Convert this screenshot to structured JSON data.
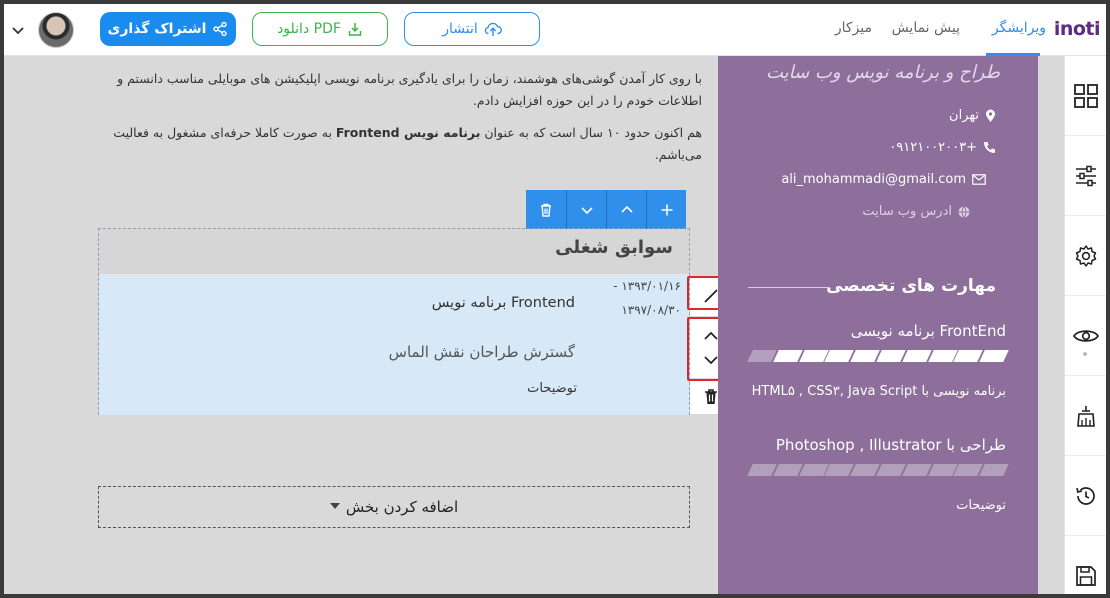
{
  "topbar": {
    "logo": "inoti",
    "nav": {
      "editor": "ویرایشگر",
      "preview": "پیش نمایش",
      "desk": "میزکار"
    },
    "buttons": {
      "publish": "انتشار",
      "pdf": "دانلود PDF",
      "share": "اشتراک گذاری"
    }
  },
  "intro": {
    "para1": "با روی کار آمدن گوشی‌های هوشمند، زمان را برای یادگیری برنامه نویسی اپلیکیشن های موبایلی مناسب دانستم و اطلاعات خودم را در این حوزه افزایش دادم.",
    "para2_before": "هم اکنون حدود ۱۰ سال است که به عنوان ",
    "para2_bold": "برنامه نویس Frontend",
    "para2_after": " به صورت کاملا حرفه‌ای مشغول به فعالیت می‌باشم."
  },
  "section": {
    "title": "سوابق شغلی",
    "date_start": "۱۳۹۳/۰۱/۱۶ -",
    "date_end": "۱۳۹۷/۰۸/۳۰",
    "job_title": "برنامه نویس Frontend",
    "company": "گسترش طراحان نقش الماس",
    "description": "توضیحات"
  },
  "add_section": {
    "label": "اضافه کردن بخش"
  },
  "sidebar": {
    "title": "طراح و برنامه نویس وب سایت",
    "city": "تهران",
    "phone": "+۰۹۱۲۱۰۰۲۰۰۳",
    "email": "ali_mohammadi@gmail.com",
    "website": "ادرس وب سایت",
    "skills_heading": "مهارت های تخصصی",
    "skill1": "برنامه نویسی FrontEnd",
    "skill1_level": 0.93,
    "skill1_desc": "HTML۵ , CSS۳, Java Script برنامه نویسی با",
    "skill2": "Photoshop , Illustrator طراحی با",
    "skill2_level": 0,
    "skill2_desc": "توضیحات"
  },
  "colors": {
    "accent": "#2f8fea",
    "sidebar": "#8e6f9b",
    "highlight": "#e3262b",
    "pdf": "#39b54a"
  },
  "icons": {
    "rail": [
      "layout-grid-icon",
      "sliders-icon",
      "settings-icon",
      "eye-icon",
      "paint-roller-icon",
      "history-icon",
      "save-icon"
    ]
  }
}
